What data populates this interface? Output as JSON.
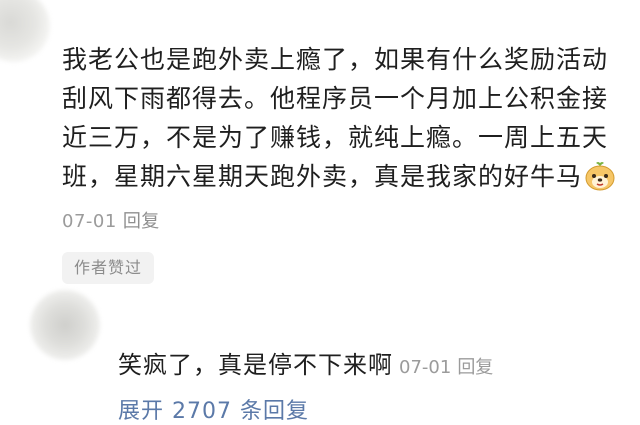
{
  "comment": {
    "text": "我老公也是跑外卖上瘾了，如果有什么奖励活动刮风下雨都得去。他程序员一个月加上公积金接近三万，不是为了赚钱，就纯上瘾。一周上五天班，星期六星期天跑外卖，真是我家的好牛马",
    "emoji_icon": "dog-face-emoji",
    "date": "07-01",
    "reply_label": "回复",
    "author_badge": "作者赞过"
  },
  "reply": {
    "text": "笑疯了，真是停不下来啊",
    "date": "07-01",
    "reply_label": "回复"
  },
  "expand": {
    "label": "展开 2707 条回复"
  },
  "colors": {
    "text": "#1f1f1f",
    "meta": "#9b9b9b",
    "badge_bg": "#f2f2f2",
    "link": "#5b79a8"
  }
}
